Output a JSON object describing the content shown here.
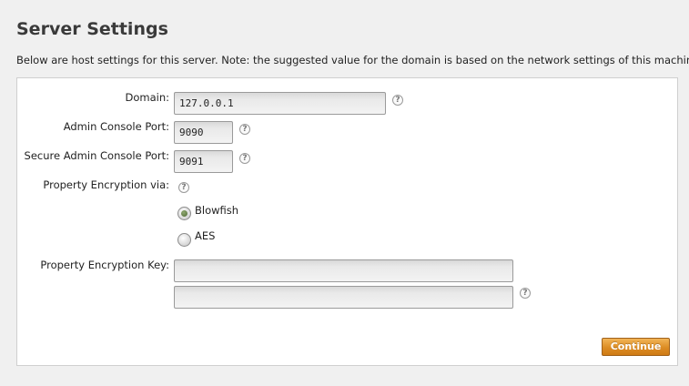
{
  "page": {
    "title": "Server Settings",
    "description": "Below are host settings for this server. Note: the suggested value for the domain is based on the network settings of this machine."
  },
  "form": {
    "domain": {
      "label": "Domain:",
      "value": "127.0.0.1",
      "help_icon": "question-mark-circle"
    },
    "admin_port": {
      "label": "Admin Console Port:",
      "value": "9090",
      "help_icon": "question-mark-circle"
    },
    "secure_admin_port": {
      "label": "Secure Admin Console Port:",
      "value": "9091",
      "help_icon": "question-mark-circle"
    },
    "encryption_via": {
      "label": "Property Encryption via:",
      "help_icon": "question-mark-circle",
      "options": [
        {
          "label": "Blowfish",
          "selected": true
        },
        {
          "label": "AES",
          "selected": false
        }
      ]
    },
    "encryption_key": {
      "label": "Property Encryption Key:",
      "value": "",
      "confirm_value": "",
      "help_icon": "question-mark-circle"
    },
    "help_glyph": "?"
  },
  "actions": {
    "continue_label": "Continue"
  },
  "colors": {
    "page_background": "#f0f0f0",
    "panel_background": "#ffffff",
    "button_orange": "#dc8c24",
    "radio_selected": "#4f6a34"
  }
}
